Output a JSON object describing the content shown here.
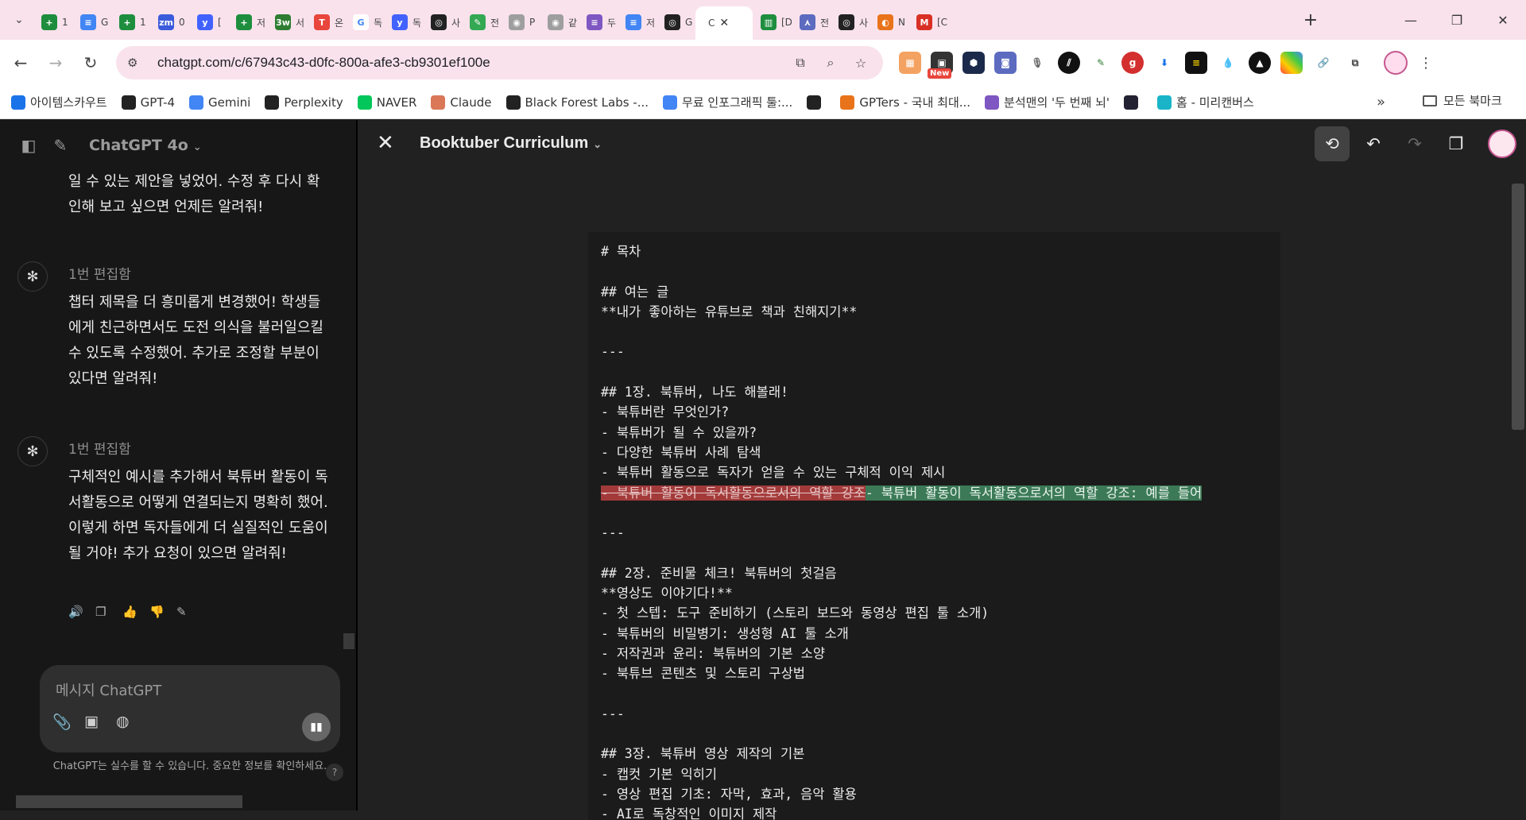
{
  "browser": {
    "tabs": [
      {
        "icon": "sheets-icon",
        "color": "#1e8e3e",
        "title": "1",
        "glyph": "+"
      },
      {
        "icon": "docs-icon",
        "color": "#4285f4",
        "title": "G",
        "glyph": "≡"
      },
      {
        "icon": "sheets-icon",
        "color": "#1e8e3e",
        "title": "1",
        "glyph": "+"
      },
      {
        "icon": "zm-icon",
        "color": "#3b5bdb",
        "title": "0",
        "glyph": "zm"
      },
      {
        "icon": "y-icon",
        "color": "#4262ff",
        "title": "[",
        "glyph": "y"
      },
      {
        "icon": "sheets-icon",
        "color": "#1e8e3e",
        "title": "저",
        "glyph": "+"
      },
      {
        "icon": "3w-icon",
        "color": "#2e7d32",
        "title": "서",
        "glyph": "3w"
      },
      {
        "icon": "t-icon",
        "color": "#e8453c",
        "title": "온",
        "glyph": "T"
      },
      {
        "icon": "google-icon",
        "color": "#ffffff",
        "title": "독",
        "glyph": "G"
      },
      {
        "icon": "y-icon",
        "color": "#4262ff",
        "title": "독",
        "glyph": "y"
      },
      {
        "icon": "openai-icon",
        "color": "#222222",
        "title": "사",
        "glyph": "◎"
      },
      {
        "icon": "leaf-icon",
        "color": "#34a853",
        "title": "전",
        "glyph": "✎"
      },
      {
        "icon": "globe-icon",
        "color": "#9e9e9e",
        "title": "P",
        "glyph": "◉"
      },
      {
        "icon": "globe-icon",
        "color": "#9e9e9e",
        "title": "같",
        "glyph": "◉"
      },
      {
        "icon": "doc-icon",
        "color": "#7e57c2",
        "title": "두",
        "glyph": "≡"
      },
      {
        "icon": "docs-icon",
        "color": "#4285f4",
        "title": "저",
        "glyph": "≡"
      },
      {
        "icon": "openai-icon",
        "color": "#222222",
        "title": "G",
        "glyph": "◎"
      }
    ],
    "active_tab": {
      "title": "C",
      "close": "✕"
    },
    "tabs_after": [
      {
        "icon": "book-icon",
        "color": "#1e8e3e",
        "title": "[D",
        "glyph": "▥"
      },
      {
        "icon": "perplexity-icon",
        "color": "#5c6bc0",
        "title": "전",
        "glyph": "⋏"
      },
      {
        "icon": "openai-icon",
        "color": "#222222",
        "title": "사",
        "glyph": "◎"
      },
      {
        "icon": "n-icon",
        "color": "#e8731a",
        "title": "N",
        "glyph": "◐"
      },
      {
        "icon": "gmail-icon",
        "color": "#d93025",
        "title": "[C",
        "glyph": "M"
      }
    ],
    "url": "chatgpt.com/c/67943c43-d0fc-800a-afe3-cb9301ef100e",
    "bookmarks": [
      {
        "label": "아이템스카우트",
        "color": "#1a73e8"
      },
      {
        "label": "GPT-4",
        "color": "#222222"
      },
      {
        "label": "Gemini",
        "color": "#4285f4"
      },
      {
        "label": "Perplexity",
        "color": "#222222"
      },
      {
        "label": "NAVER",
        "color": "#03c75a"
      },
      {
        "label": "Claude",
        "color": "#d97757"
      },
      {
        "label": "Black Forest Labs -...",
        "color": "#222222"
      },
      {
        "label": "무료 인포그래픽 툴:...",
        "color": "#4285f4"
      },
      {
        "label": "",
        "color": "#222222"
      },
      {
        "label": "GPTers - 국내 최대...",
        "color": "#e8731a"
      },
      {
        "label": "분석맨의 '두 번째 뇌'",
        "color": "#7e57c2"
      },
      {
        "label": "",
        "color": "#222233"
      },
      {
        "label": "홈 - 미리캔버스",
        "color": "#19b4c8"
      }
    ],
    "all_bookmarks": "모든 북마크",
    "more": "»",
    "new_badge": "New"
  },
  "sidebar": {
    "model": "ChatGPT 4o",
    "fragment": "일 수 있는 제안을 넣었어. 수정 후 다시 확인해 보고 싶으면 언제든 알려줘!",
    "messages": [
      {
        "label": "1번 편집함",
        "text": "챕터 제목을 더 흥미롭게 변경했어! 학생들에게 친근하면서도 도전 의식을 불러일으킬 수 있도록 수정했어. 추가로 조정할 부분이 있다면 알려줘!"
      },
      {
        "label": "1번 편집함",
        "text": "구체적인 예시를 추가해서 북튜버 활동이 독서활동으로 어떻게 연결되는지 명확히 했어. 이렇게 하면 독자들에게 더 실질적인 도움이 될 거야! 추가 요청이 있으면 알려줘!"
      }
    ],
    "composer_placeholder": "메시지 ChatGPT",
    "disclaimer": "ChatGPT는 실수를 할 수 있습니다. 중요한 정보를 확인하세요.",
    "help": "?"
  },
  "canvas": {
    "title": "Booktuber Curriculum",
    "lines": [
      {
        "text": "# 목차",
        "bold": false
      },
      {
        "text": "",
        "bold": false
      },
      {
        "text": "## 여는 글",
        "bold": false
      },
      {
        "text": "**내가 좋아하는 유튜브로 책과 친해지기**",
        "bold": false
      },
      {
        "text": "",
        "bold": false
      },
      {
        "text": "---",
        "bold": false
      },
      {
        "text": "",
        "bold": false
      },
      {
        "text": "## 1장. 북튜버, 나도 해볼래!",
        "bold": false
      },
      {
        "text": "- 북튜버란 무엇인가?",
        "bold": false
      },
      {
        "text": "- 북튜버가 될 수 있을까?",
        "bold": false
      },
      {
        "text": "- 다양한 북튜버 사례 탐색",
        "bold": false
      },
      {
        "text": "- 북튜버 활동으로 독자가 얻을 수 있는 구체적 이익 제시",
        "bold": false
      }
    ],
    "diff_line": {
      "deleted": "- 북튜버 활동이 독서활동으로서의 역할 강조",
      "inserted": "- 북튜버 활동이 독서활동으로서의 역할 강조: 예를 들어"
    },
    "lines2": [
      {
        "text": "",
        "bold": false
      },
      {
        "text": "---",
        "bold": false
      },
      {
        "text": "",
        "bold": false
      },
      {
        "text": "## 2장. 준비물 체크! 북튜버의 첫걸음",
        "bold": false
      },
      {
        "text": "**영상도 이야기다!**",
        "bold": false
      },
      {
        "text": "- 첫 스텝: 도구 준비하기 (스토리 보드와 동영상 편집 툴 소개)",
        "bold": false
      },
      {
        "text": "- 북튜버의 비밀병기: 생성형 AI 툴 소개",
        "bold": false
      },
      {
        "text": "- 저작권과 윤리: 북튜버의 기본 소양",
        "bold": false
      },
      {
        "text": "- 북튜브 콘텐츠 및 스토리 구상법",
        "bold": false
      },
      {
        "text": "",
        "bold": false
      },
      {
        "text": "---",
        "bold": false
      },
      {
        "text": "",
        "bold": false
      },
      {
        "text": "## 3장. 북튜버 영상 제작의 기본",
        "bold": false
      },
      {
        "text": "- 캡컷 기본 익히기",
        "bold": false
      },
      {
        "text": "- 영상 편집 기초: 자막, 효과, 음악 활용",
        "bold": false
      },
      {
        "text": "- AI로 독창적인 이미지 제작",
        "bold": false
      }
    ]
  }
}
